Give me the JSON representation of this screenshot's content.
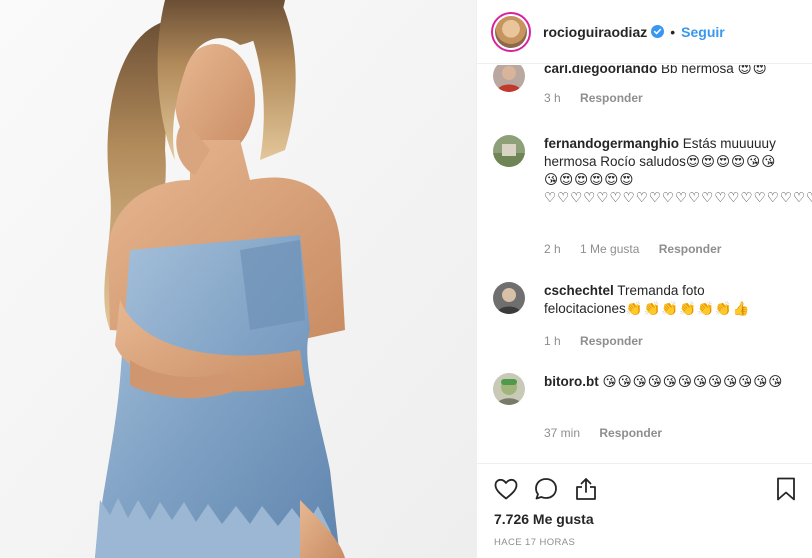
{
  "post": {
    "username": "rocioguiraodiaz",
    "verified": true,
    "separator": "•",
    "follow_label": "Seguir",
    "colors": {
      "accent": "#3897f0",
      "text": "#262626",
      "muted": "#8e8e8e",
      "verified_badge": "#3897f0"
    }
  },
  "comments": [
    {
      "username": "carl.diegoorlando",
      "text": " Bb hermosa ",
      "emoji": "😍😍",
      "time": "3 h",
      "likes": "",
      "reply": "Responder"
    },
    {
      "username": "fernandogermanghio",
      "text": " Estás muuuuuy hermosa Rocío saludos",
      "emoji": "😍😍😍😍😘😘😘😍😍😍😍😍♡♡♡♡♡♡♡♡♡♡♡♡♡♡♡♡♡♡♡♡♡♡",
      "time": "2 h",
      "likes": "1 Me gusta",
      "reply": "Responder"
    },
    {
      "username": "cschechtel",
      "text": " Tremanda foto felocitaciones",
      "emoji": "👏👏👏👏👏👏👍",
      "time": "1 h",
      "likes": "",
      "reply": "Responder"
    },
    {
      "username": "bitoro.bt",
      "text": " ",
      "emoji": "😘😘😘😘😘😘😘😘😘😘😘😘",
      "time": "37 min",
      "likes": "",
      "reply": "Responder"
    }
  ],
  "actions": {
    "icons": [
      "heart-icon",
      "comment-icon",
      "share-icon",
      "bookmark-icon"
    ],
    "likes_count": "7.726 Me gusta",
    "time_ago": "HACE 17 HORAS"
  }
}
